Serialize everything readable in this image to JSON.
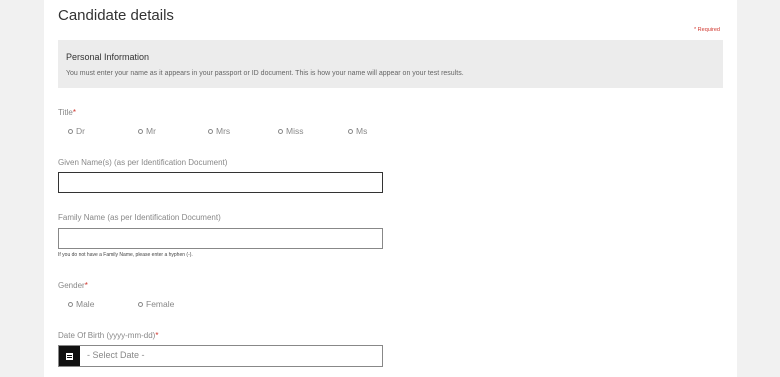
{
  "page_title": "Candidate details",
  "required_note": "* Required",
  "info": {
    "heading": "Personal Information",
    "text": "You must enter your name as it appears in your passport or ID document. This is how your name will appear on your test results."
  },
  "title_field": {
    "label": "Title",
    "required_mark": "*",
    "options": [
      "Dr",
      "Mr",
      "Mrs",
      "Miss",
      "Ms"
    ]
  },
  "given_name": {
    "label": "Given Name(s) (as per Identification Document)",
    "value": ""
  },
  "family_name": {
    "label": "Family Name (as per Identification Document)",
    "value": "",
    "hint": "If you do not have a Family Name, please enter a hyphen (-)."
  },
  "gender": {
    "label": "Gender",
    "required_mark": "*",
    "options": [
      "Male",
      "Female"
    ]
  },
  "dob": {
    "label": "Date Of Birth (yyyy-mm-dd)",
    "required_mark": "*",
    "placeholder": "- Select Date -",
    "icon": "calendar-icon"
  },
  "colors": {
    "page_bg": "#f1f1f1",
    "panel_bg": "#ffffff",
    "info_bg": "#ececec",
    "required": "#d0342c",
    "calendar_button": "#111111"
  }
}
